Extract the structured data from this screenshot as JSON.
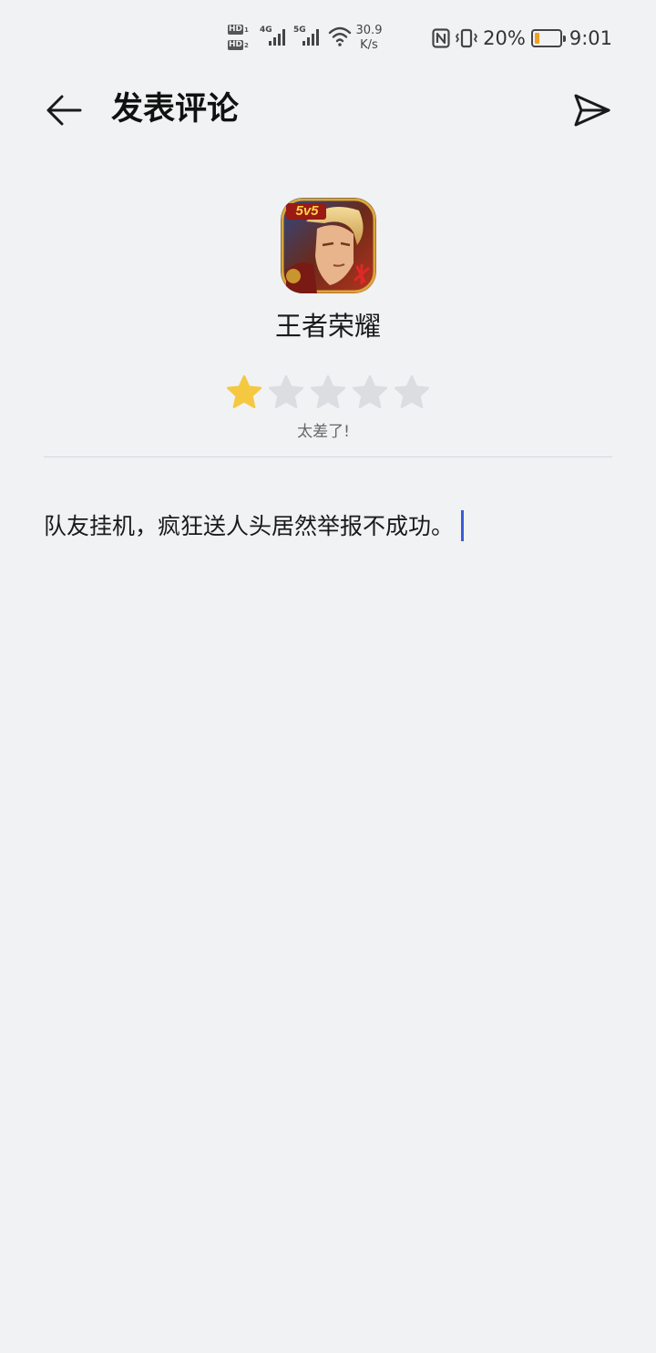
{
  "status_bar": {
    "hd1": "HD",
    "hd1_sub": "1",
    "hd2": "HD",
    "hd2_sub": "2",
    "network1": "4G",
    "network2": "5G",
    "speed_value": "30.9",
    "speed_unit": "K/s",
    "battery_percent": "20%",
    "battery_level": 0.2,
    "battery_color": "#f0a020",
    "time": "9:01",
    "icons": [
      "nfc-icon",
      "vibrate-icon",
      "wifi-icon",
      "signal-icon",
      "battery-icon"
    ]
  },
  "header": {
    "title": "发表评论",
    "back_icon": "arrow-left-icon",
    "send_icon": "send-icon"
  },
  "app": {
    "name": "王者荣耀",
    "icon_badge": "5v5"
  },
  "rating": {
    "value": 1,
    "max": 5,
    "label": "太差了!",
    "filled_color": "#f5c842",
    "empty_color": "#dcdde0"
  },
  "comment": {
    "text": "队友挂机，疯狂送人头居然举报不成功。",
    "caret_color": "#3b5bdb"
  }
}
